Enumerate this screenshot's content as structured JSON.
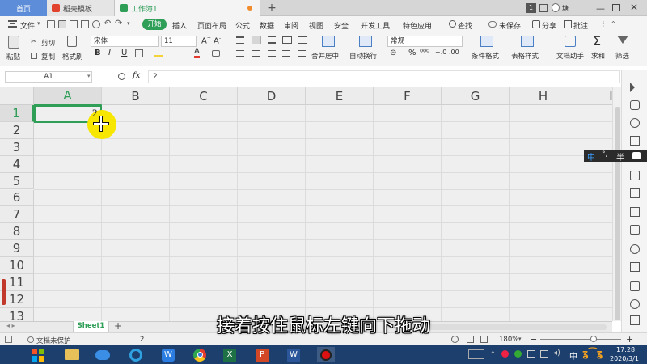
{
  "tabs": {
    "home": "首页",
    "daoke": "稻壳模板",
    "book": "工作簿1",
    "page_num": "1",
    "user": "塘"
  },
  "menu": {
    "file": "文件",
    "items": [
      "开始",
      "插入",
      "页面布局",
      "公式",
      "数据",
      "审阅",
      "视图",
      "安全",
      "开发工具",
      "特色应用"
    ],
    "search": "查找",
    "unsaved": "未保存",
    "share": "分享",
    "annotate": "批注"
  },
  "ribbon": {
    "cut": "剪切",
    "paste": "粘贴",
    "copy": "复制",
    "format_painter": "格式刷",
    "font_name": "宋体",
    "font_size": "11",
    "number_format": "常规",
    "merge_center": "合并居中",
    "wrap_text": "自动换行",
    "cond_format": "条件格式",
    "table_style": "表格样式",
    "doc_helper": "文档助手",
    "sum": "求和",
    "filter": "筛选"
  },
  "formula": {
    "cell_ref": "A1",
    "fx": "fx",
    "value": "2"
  },
  "columns": [
    "A",
    "B",
    "C",
    "D",
    "E",
    "F",
    "G",
    "H",
    "I"
  ],
  "rows": [
    "1",
    "2",
    "3",
    "4",
    "5",
    "6",
    "7",
    "8",
    "9",
    "10",
    "11",
    "12",
    "13"
  ],
  "cell_a1": "2",
  "ime": {
    "zh": "中",
    "punct": "°,",
    "half": "半"
  },
  "subtitle": "接着按住鼠标左键向下拖动",
  "sheet": {
    "name": "Sheet1",
    "add": "+"
  },
  "status": {
    "protect": "文档未保护",
    "value": "2",
    "zoom": "180%"
  },
  "taskbar": {
    "ime": "中",
    "time": "17:28",
    "date": "2020/3/1"
  }
}
